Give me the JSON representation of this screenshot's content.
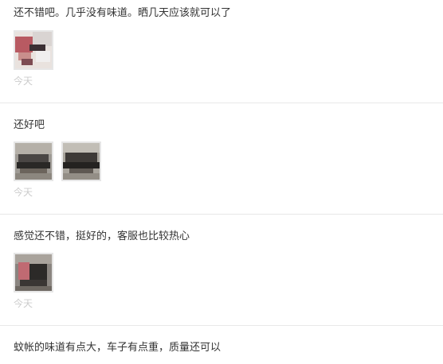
{
  "reviews": [
    {
      "text": "还不错吧。几乎没有味道。晒几天应该就可以了",
      "time": "今天",
      "photos": [
        "review-photo-1"
      ]
    },
    {
      "text": "还好吧",
      "time": "今天",
      "photos": [
        "review-photo-1",
        "review-photo-2"
      ]
    },
    {
      "text": "感觉还不错，挺好的，客服也比较热心",
      "time": "今天",
      "photos": [
        "review-photo-1"
      ]
    },
    {
      "text": "蚊帐的味道有点大，车子有点重，质量还可以",
      "time": "",
      "photos": []
    }
  ],
  "colors": {
    "text": "#333333",
    "time": "#cccccc",
    "divider": "#e8e8e8",
    "thumb_border": "#e6e6e6"
  }
}
